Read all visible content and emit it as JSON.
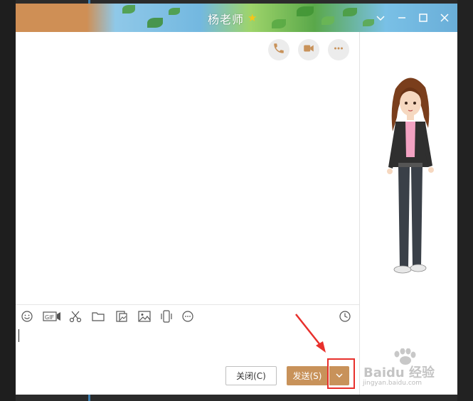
{
  "window": {
    "title": "杨老师",
    "title_star_icon": "star-icon"
  },
  "window_controls": {
    "icons": [
      "chevron-down-icon",
      "minimize-icon",
      "maximize-icon",
      "close-icon"
    ]
  },
  "chat_header_buttons": [
    {
      "name": "phone-call-button",
      "icon": "phone-icon"
    },
    {
      "name": "video-call-button",
      "icon": "video-icon"
    },
    {
      "name": "more-button",
      "icon": "more-dots-icon"
    }
  ],
  "toolbar": {
    "tools": [
      "emoji-icon",
      "gif-icon",
      "screenshot-scissors-icon",
      "folder-icon",
      "image-collection-icon",
      "image-icon",
      "shake-icon",
      "more-icon"
    ],
    "history_icon": "clock-icon"
  },
  "input": {
    "value": ""
  },
  "actions": {
    "close_label": "关闭(C)",
    "send_label": "发送(S)",
    "send_dropdown_icon": "chevron-down-icon"
  },
  "watermark": {
    "main": "Baidu 经验",
    "sub": "jingyan.baidu.com"
  },
  "colors": {
    "accent": "#c8925a",
    "highlight": "#e8302c"
  }
}
